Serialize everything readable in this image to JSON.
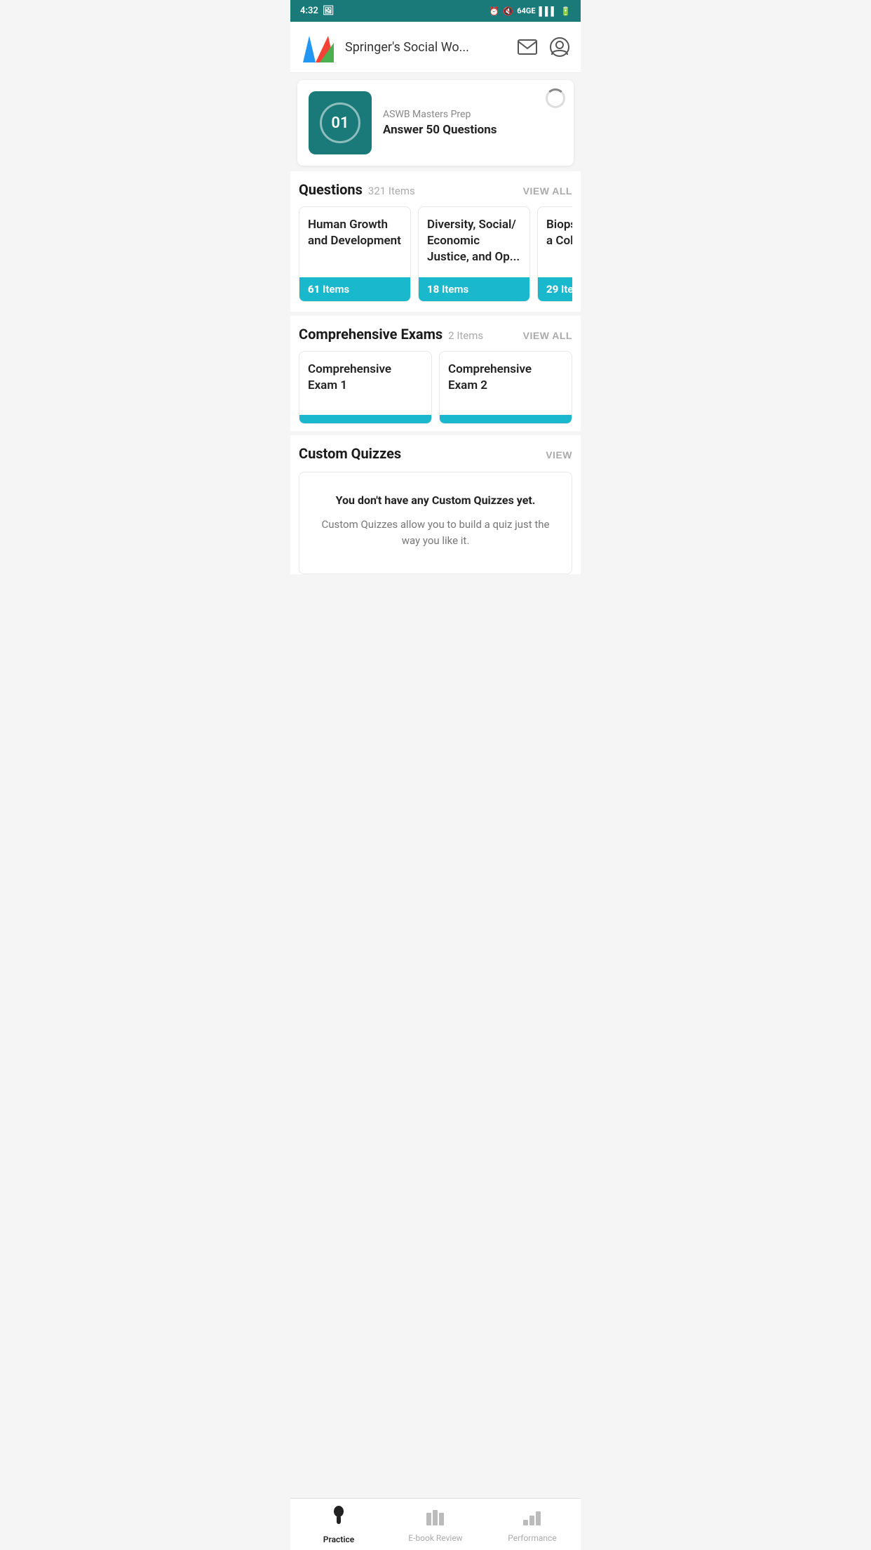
{
  "statusBar": {
    "time": "4:32",
    "icons": [
      "photo",
      "alarm",
      "mute",
      "wifi",
      "lte",
      "signal",
      "battery"
    ]
  },
  "header": {
    "title": "Springer's Social Wo...",
    "logoAlt": "Springer Social Work Logo"
  },
  "featuredCard": {
    "number": "01",
    "subtitle": "ASWB Masters Prep",
    "title": "Answer 50 Questions"
  },
  "questionsSection": {
    "title": "Questions",
    "count": "321 Items",
    "viewAll": "VIEW ALL",
    "cards": [
      {
        "title": "Human Growth and Development",
        "items": "61",
        "itemsLabel": "Items"
      },
      {
        "title": "Diversity, Social/ Economic Justice, and Op...",
        "items": "18",
        "itemsLabel": "Items"
      },
      {
        "title": "Biopsych History a Collatera",
        "items": "29",
        "itemsLabel": "Items"
      }
    ]
  },
  "comprehensiveExamsSection": {
    "title": "Comprehensive Exams",
    "count": "2 Items",
    "viewAll": "VIEW ALL",
    "cards": [
      {
        "title": "Comprehensive Exam 1"
      },
      {
        "title": "Comprehensive Exam 2"
      }
    ]
  },
  "customQuizzesSection": {
    "title": "Custom Quizzes",
    "viewLabel": "VIEW",
    "emptyTitle": "You don't have any Custom Quizzes yet.",
    "emptyDesc": "Custom Quizzes allow you to build a quiz just the way you like it."
  },
  "bottomNav": {
    "items": [
      {
        "id": "practice",
        "label": "Practice",
        "active": true
      },
      {
        "id": "ebook",
        "label": "E-book Review",
        "active": false
      },
      {
        "id": "performance",
        "label": "Performance",
        "active": false
      }
    ]
  }
}
